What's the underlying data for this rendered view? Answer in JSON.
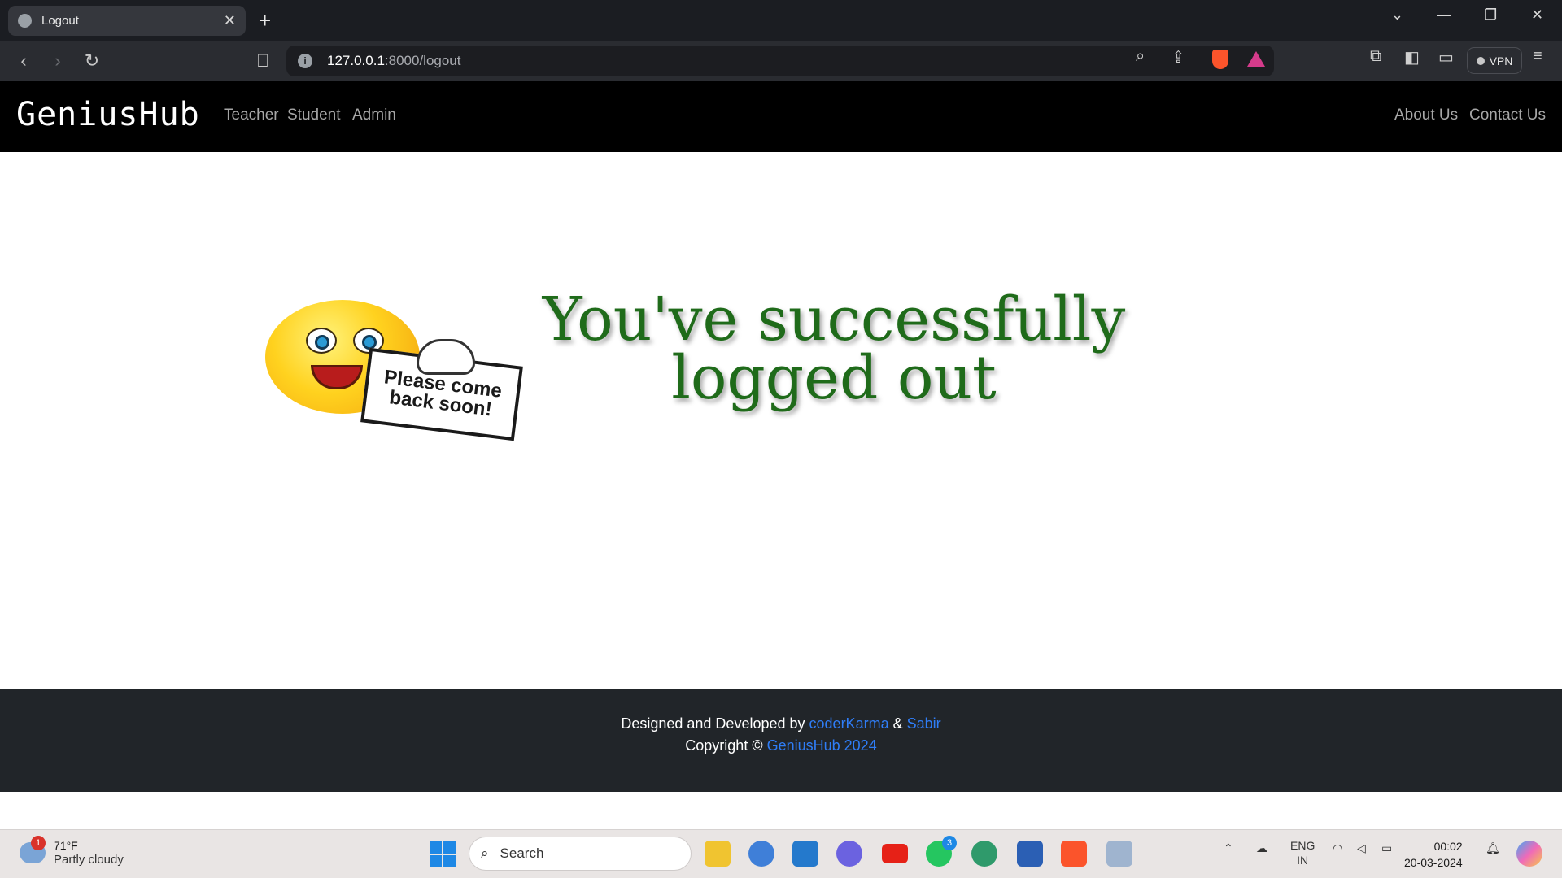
{
  "browser": {
    "tab_title": "Logout",
    "new_tab_label": "+",
    "url_host": "127.0.0.1",
    "url_rest": ":8000/logout",
    "vpn_label": "VPN"
  },
  "navbar": {
    "brand": "GeniusHub",
    "links_left": [
      "Teacher",
      "Student",
      "Admin"
    ],
    "links_right": [
      "About Us",
      "Contact Us"
    ]
  },
  "logout_image": {
    "headline_line1": "You've successfully",
    "headline_line2": "logged out",
    "sign_line1": "Please come",
    "sign_line2": "back soon!"
  },
  "footer": {
    "designed_by": "Designed and Developed by",
    "author1": "coderKarma",
    "amp": "&",
    "author2": "Sabir",
    "copyright": "Copyright ©",
    "copyright_link": "GeniusHub 2024"
  },
  "taskbar": {
    "weather_temp": "71°F",
    "weather_desc": "Partly cloudy",
    "weather_badge": "1",
    "search_label": "Search",
    "whatsapp_badge": "3",
    "lang_line1": "ENG",
    "lang_line2": "IN",
    "time": "00:02",
    "date": "20-03-2024"
  },
  "colors": {
    "accent_link": "#2f7df6",
    "headline_green": "#1f6b1a",
    "navbar_bg": "#000000",
    "footer_bg": "#212529"
  }
}
